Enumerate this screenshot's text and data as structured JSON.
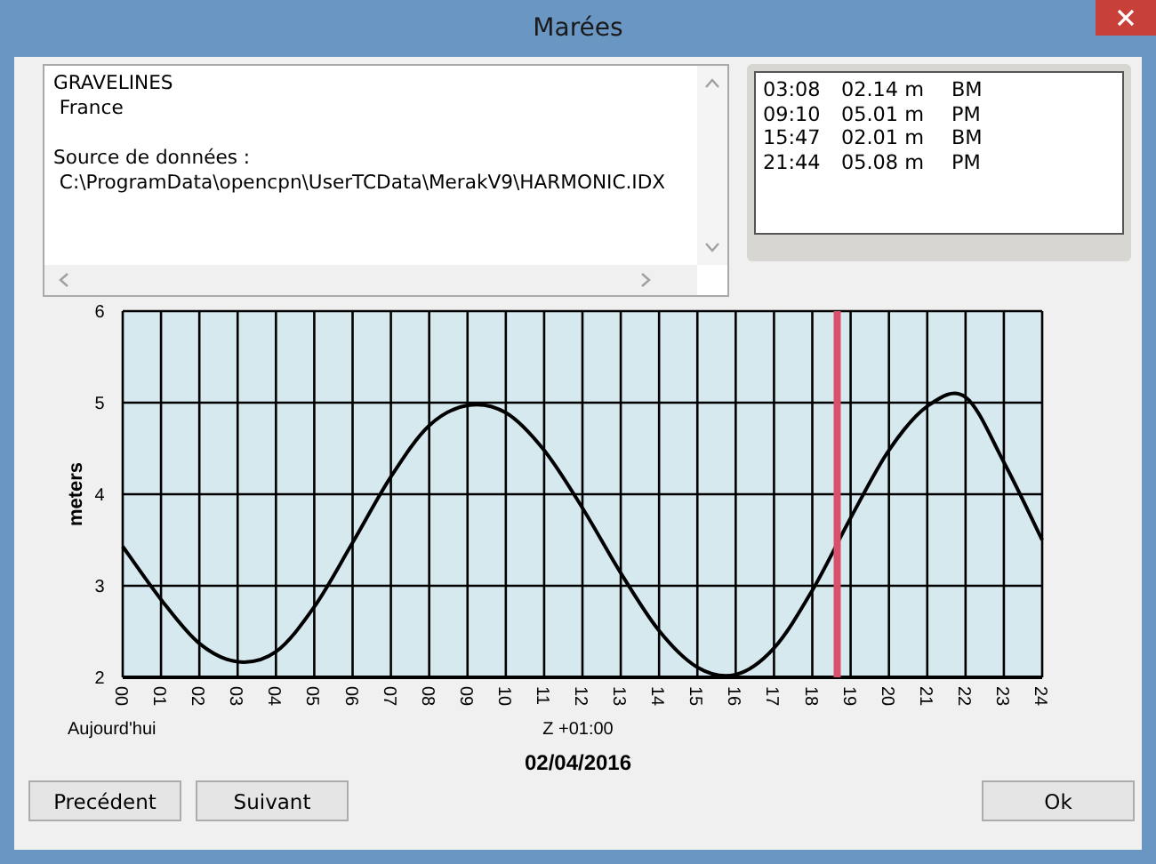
{
  "window": {
    "title": "Marées"
  },
  "info": {
    "station": [
      "GRAVELINES",
      " France"
    ],
    "source": [
      "Source de données :",
      " C:\\ProgramData\\opencpn\\UserTCData\\MerakV9\\HARMONIC.IDX"
    ]
  },
  "tides": [
    {
      "time": "03:08",
      "height": "02.14 m",
      "type": "BM"
    },
    {
      "time": "09:10",
      "height": "05.01 m",
      "type": "PM"
    },
    {
      "time": "15:47",
      "height": "02.01 m",
      "type": "BM"
    },
    {
      "time": "21:44",
      "height": "05.08 m",
      "type": "PM"
    }
  ],
  "chart": {
    "day_label": "Aujourd'hui",
    "date": "02/04/2016",
    "chart_data": {
      "type": "line",
      "xlabel": "Z +01:00",
      "ylabel": "meters",
      "x": [
        0,
        1,
        2,
        3,
        4,
        5,
        6,
        7,
        8,
        9,
        10,
        11,
        12,
        13,
        14,
        15,
        16,
        17,
        18,
        19,
        20,
        21,
        22,
        23,
        24
      ],
      "series": [
        {
          "color": "#000000",
          "values": [
            3.43,
            2.85,
            2.37,
            2.17,
            2.28,
            2.77,
            3.47,
            4.19,
            4.75,
            4.97,
            4.89,
            4.48,
            3.85,
            3.14,
            2.51,
            2.11,
            2.03,
            2.32,
            2.95,
            3.74,
            4.48,
            4.96,
            5.06,
            4.35,
            3.5
          ]
        }
      ],
      "xlim": [
        0,
        24
      ],
      "ylim": [
        2,
        6
      ],
      "xticks": [
        {
          "value": 0,
          "label": "00"
        },
        {
          "value": 1,
          "label": "01"
        },
        {
          "value": 2,
          "label": "02"
        },
        {
          "value": 3,
          "label": "03"
        },
        {
          "value": 4,
          "label": "04"
        },
        {
          "value": 5,
          "label": "05"
        },
        {
          "value": 6,
          "label": "06"
        },
        {
          "value": 7,
          "label": "07"
        },
        {
          "value": 8,
          "label": "08"
        },
        {
          "value": 9,
          "label": "09"
        },
        {
          "value": 10,
          "label": "10"
        },
        {
          "value": 11,
          "label": "11"
        },
        {
          "value": 12,
          "label": "12"
        },
        {
          "value": 13,
          "label": "13"
        },
        {
          "value": 14,
          "label": "14"
        },
        {
          "value": 15,
          "label": "15"
        },
        {
          "value": 16,
          "label": "16"
        },
        {
          "value": 17,
          "label": "17"
        },
        {
          "value": 18,
          "label": "18"
        },
        {
          "value": 19,
          "label": "19"
        },
        {
          "value": 20,
          "label": "20"
        },
        {
          "value": 21,
          "label": "21"
        },
        {
          "value": 22,
          "label": "22"
        },
        {
          "value": 23,
          "label": "23"
        },
        {
          "value": 24,
          "label": "24"
        }
      ],
      "yticks": [
        2,
        3,
        4,
        5,
        6
      ],
      "grid": true,
      "ref_lines": [
        {
          "axis": "x",
          "value": 18.65,
          "color": "#d9506a"
        }
      ]
    }
  },
  "nav_buttons": [
    "Precédent",
    "Suivant"
  ],
  "confirm_button": "Ok"
}
